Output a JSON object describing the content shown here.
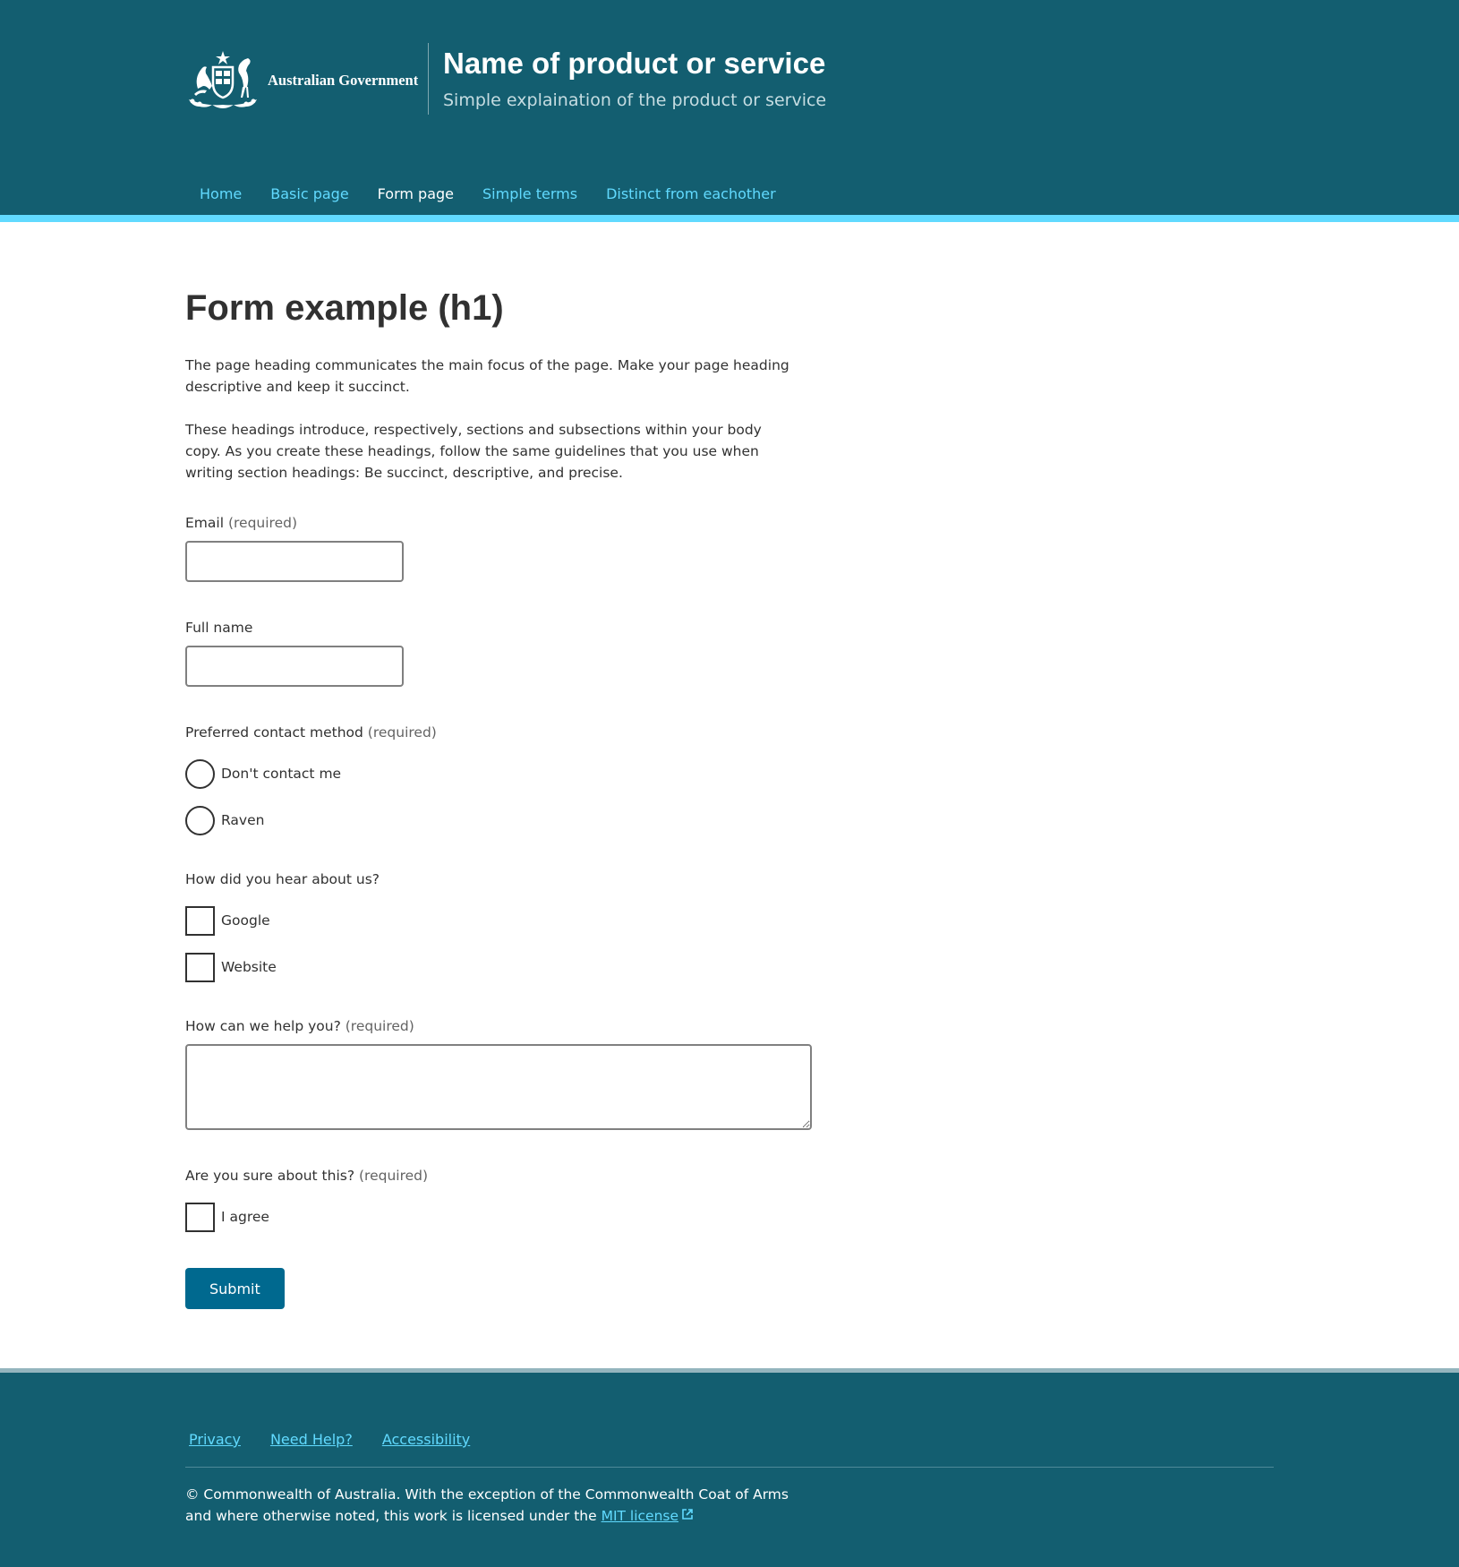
{
  "header": {
    "government_name": "Australian Government",
    "product_name": "Name of product or service",
    "product_description": "Simple explaination of the product or service",
    "crest_icon": "coat-of-arms-icon",
    "colors": {
      "background": "#135e70",
      "accent": "#61daff",
      "active_indicator": "#104b5a"
    }
  },
  "nav": {
    "items": [
      {
        "label": "Home"
      },
      {
        "label": "Basic page"
      },
      {
        "label": "Form page",
        "active": true
      },
      {
        "label": "Simple terms"
      },
      {
        "label": "Distinct from eachother"
      }
    ]
  },
  "main": {
    "heading": "Form example (h1)",
    "intro_paragraphs": [
      "The page heading communicates the main focus of the page. Make your page heading descriptive and keep it succinct.",
      "These headings introduce, respectively, sections and subsections within your body copy. As you create these headings, follow the same guidelines that you use when writing section headings: Be succinct, descriptive, and precise."
    ]
  },
  "form": {
    "required_text": "(required)",
    "email": {
      "label": "Email",
      "value": ""
    },
    "full_name": {
      "label": "Full name",
      "value": ""
    },
    "contact_method": {
      "label": "Preferred contact method",
      "options": [
        "Don't contact me",
        "Raven"
      ]
    },
    "hear_about": {
      "label": "How did you hear about us?",
      "options": [
        "Google",
        "Website"
      ]
    },
    "help": {
      "label": "How can we help you?",
      "value": ""
    },
    "confirm": {
      "label": "Are you sure about this?",
      "option": "I agree"
    },
    "submit_label": "Submit",
    "colors": {
      "button": "#00698f"
    }
  },
  "footer": {
    "links": [
      "Privacy",
      "Need Help?",
      "Accessibility"
    ],
    "copyright_text": "© Commonwealth of Australia. With the exception of the Commonwealth Coat of Arms and where otherwise noted, this work is licensed under the",
    "license_link": "MIT license",
    "external_icon": "external-link-icon"
  }
}
